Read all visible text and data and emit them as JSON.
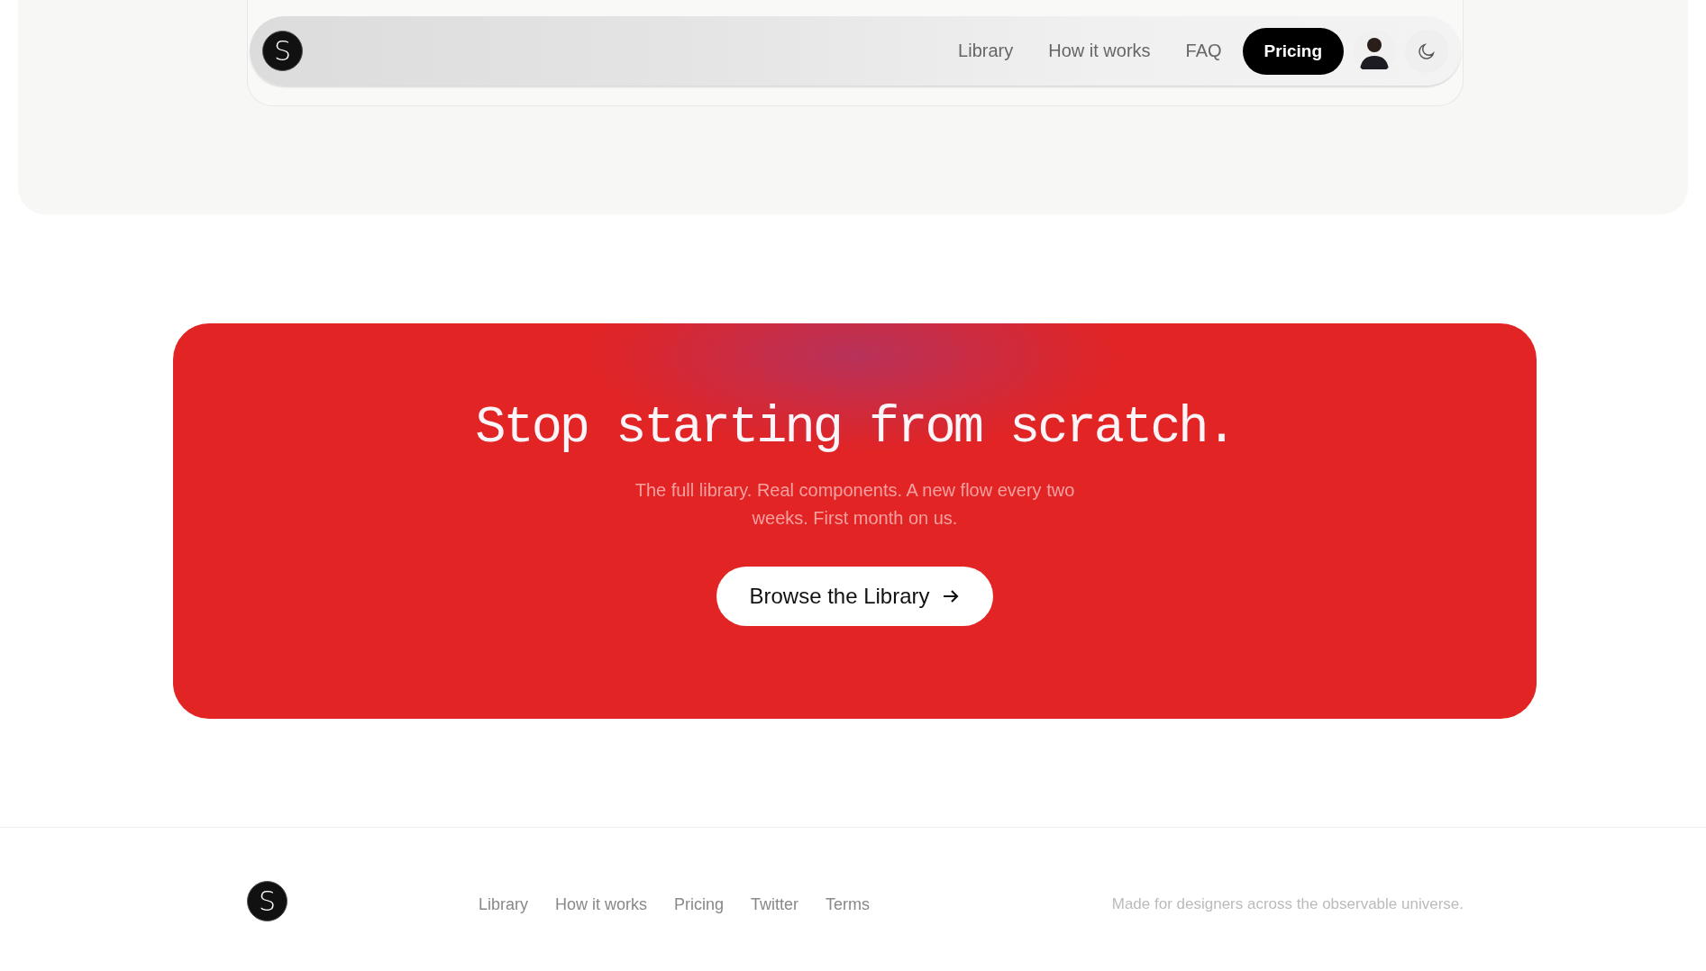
{
  "header": {
    "logo": "S",
    "nav": [
      {
        "label": "Library",
        "kind": "link"
      },
      {
        "label": "How it works",
        "kind": "link"
      },
      {
        "label": "FAQ",
        "kind": "link"
      },
      {
        "label": "Pricing",
        "kind": "button"
      }
    ]
  },
  "cta": {
    "title": "Stop starting from scratch.",
    "subtitle": "The full library. Real components. A new flow every two weeks. First month on us.",
    "button": "Browse the Library"
  },
  "footer": {
    "logo": "S",
    "links": [
      "Library",
      "How it works",
      "Pricing",
      "Twitter",
      "Terms"
    ],
    "tagline": "Made for designers across the observable universe."
  }
}
